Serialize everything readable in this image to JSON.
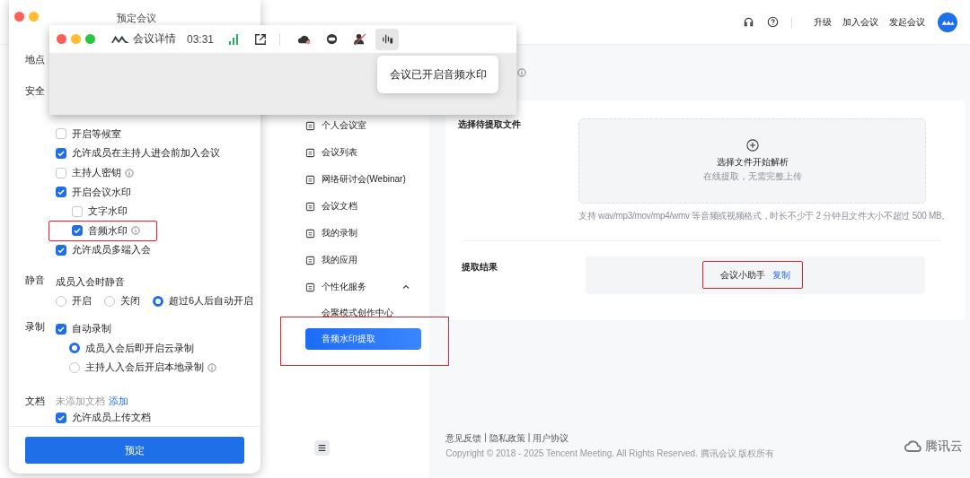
{
  "web_page": {
    "header_links": [
      "升级",
      "加入会议",
      "发起会议"
    ],
    "sidebar": {
      "items": [
        {
          "label": "个人会议室",
          "selected": false
        },
        {
          "label": "会议列表",
          "selected": false
        },
        {
          "label": "网络研讨会(Webinar)",
          "selected": false
        },
        {
          "label": "会议文档",
          "selected": false
        },
        {
          "label": "我的录制",
          "selected": false
        },
        {
          "label": "我的应用",
          "selected": false
        },
        {
          "label": "个性化服务",
          "selected": false,
          "expanded": true,
          "children": [
            {
              "label": "会聚模式创作中心",
              "selected": false
            },
            {
              "label": "音频水印提取",
              "selected": true,
              "highlighted": true
            }
          ]
        }
      ]
    },
    "file_section": {
      "label": "选择待提取文件",
      "upload_title": "选择文件开始解析",
      "upload_hint": "在线提取，无需完整上传",
      "note": "支持 wav/mp3/mov/mp4/wmv 等音频或视频格式，时长不少于 2 分钟且文件大小不超过 500 MB。"
    },
    "result_section": {
      "label": "提取结果",
      "value": "会议小助手",
      "copy_link": "复制",
      "highlighted": true
    },
    "footer": {
      "links": [
        "意见反馈",
        "隐私政策",
        "用户协议"
      ],
      "separator": "|",
      "copyright": "Copyright © 2018 - 2025 Tencent Meeting. All Rights Reserved. 腾讯会议 版权所有",
      "brand": "腾讯云"
    }
  },
  "schedule_dialog": {
    "title": "预定会议",
    "location_label": "地点",
    "security": {
      "label": "安全",
      "options": [
        {
          "label": "开启等候室",
          "checked": false
        },
        {
          "label": "允许成员在主持人进会前加入会议",
          "checked": true
        },
        {
          "label": "主持人密钥",
          "checked": false,
          "info": true
        },
        {
          "label": "开启会议水印",
          "checked": true,
          "children": [
            {
              "label": "文字水印",
              "checked": false
            },
            {
              "label": "音频水印",
              "checked": true,
              "info": true,
              "highlighted": true
            }
          ]
        },
        {
          "label": "允许成员多端入会",
          "checked": true
        }
      ]
    },
    "mute": {
      "label": "静音",
      "title": "成员入会时静音",
      "options": [
        {
          "label": "开启",
          "selected": false
        },
        {
          "label": "关闭",
          "selected": false
        },
        {
          "label": "超过6人后自动开启",
          "selected": true
        }
      ]
    },
    "recording": {
      "label": "录制",
      "auto": {
        "label": "自动录制",
        "checked": true
      },
      "modes": [
        {
          "label": "成员入会后即开启云录制",
          "selected": true
        },
        {
          "label": "主持人入会后开启本地录制",
          "selected": false,
          "info": true
        }
      ]
    },
    "documents": {
      "label": "文档",
      "status": "未添加文档",
      "add_link": "添加",
      "upload": {
        "label": "允许成员上传文档",
        "checked": true
      }
    },
    "submit_button": "预定"
  },
  "meeting_window": {
    "title": "会议详情",
    "timer": "03:31",
    "toolbar_buttons": [
      {
        "selected": false
      },
      {
        "selected": false
      },
      {
        "selected": false
      },
      {
        "selected": true
      }
    ],
    "tooltip": "会议已开启音频水印"
  }
}
